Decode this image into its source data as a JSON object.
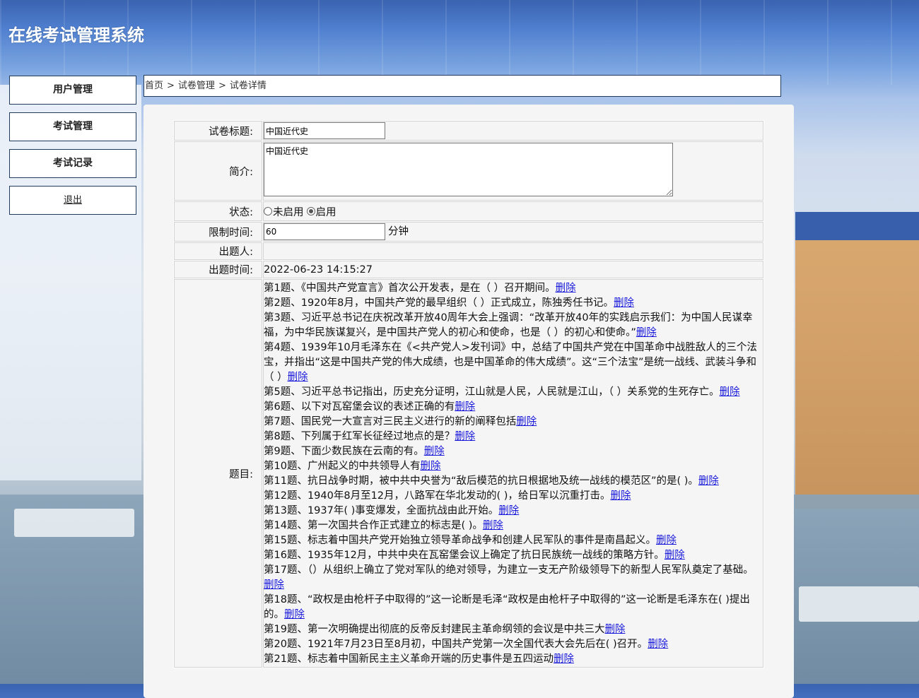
{
  "app": {
    "title": "在线考试管理系统"
  },
  "sidebar": {
    "items": [
      {
        "label": "用户管理"
      },
      {
        "label": "考试管理"
      },
      {
        "label": "考试记录"
      },
      {
        "label": "退出"
      }
    ]
  },
  "breadcrumb": {
    "items": [
      "首页",
      "试卷管理",
      "试卷详情"
    ],
    "separator": ">"
  },
  "form": {
    "title_label": "试卷标题:",
    "title_value": "中国近代史",
    "intro_label": "简介:",
    "intro_value": "中国近代史",
    "status_label": "状态:",
    "status_options": [
      "未启用",
      "启用"
    ],
    "status_selected": "启用",
    "time_limit_label": "限制时间:",
    "time_limit_value": "60",
    "time_limit_unit": "分钟",
    "author_label": "出题人:",
    "author_value": "",
    "created_label": "出题时间:",
    "created_value": "2022-06-23 14:15:27",
    "questions_label": "题目:"
  },
  "delete_label": "删除",
  "questions": [
    "第1题、《中国共产党宣言》首次公开发表，是在（ ）召开期间。",
    "第2题、1920年8月，中国共产党的最早组织（ ）正式成立，陈独秀任书记。",
    "第3题、习近平总书记在庆祝改革开放40周年大会上强调：“改革开放40年的实践启示我们：为中国人民谋幸福，为中华民族谋复兴，是中国共产党人的初心和使命，也是（ ）的初心和使命。”",
    "第4题、1939年10月毛泽东在《<共产党人>发刊词》中，总结了中国共产党在中国革命中战胜敌人的三个法宝，并指出“这是中国共产党的伟大成绩，也是中国革命的伟大成绩”。这“三个法宝”是统一战线、武装斗争和（ ）",
    "第5题、习近平总书记指出，历史充分证明，江山就是人民，人民就是江山，（ ）关系党的生死存亡。",
    "第6题、以下对瓦窑堡会议的表述正确的有",
    "第7题、国民党一大宣言对三民主义进行的新的阐释包括",
    "第8题、下列属于红军长征经过地点的是？",
    "第9题、下面少数民族在云南的有。",
    "第10题、广州起义的中共领导人有",
    "第11题、抗日战争时期，被中共中央誉为“敌后模范的抗日根据地及统一战线的模范区”的是( )。",
    "第12题、1940年8月至12月，八路军在华北发动的( )，给日军以沉重打击。",
    "第13题、1937年( )事变爆发，全面抗战由此开始。",
    "第14题、第一次国共合作正式建立的标志是( )。",
    "第15题、标志着中国共产党开始独立领导革命战争和创建人民军队的事件是南昌起义。",
    "第16题、1935年12月，中共中央在瓦窑堡会议上确定了抗日民族统一战线的策略方针。",
    "第17题、（）从组织上确立了党对军队的绝对领导，为建立一支无产阶级领导下的新型人民军队奠定了基础。",
    "第18题、“政权是由枪杆子中取得的”这一论断是毛泽“政权是由枪杆子中取得的”这一论断是毛泽东在( )提出的。",
    "第19题、第一次明确提出彻底的反帝反封建民主革命纲领的会议是中共三大",
    "第20题、1921年7月23日至8月初，中国共产党第一次全国代表大会先后在( )召开。",
    "第21题、标志着中国新民主主义革命开端的历史事件是五四运动"
  ]
}
